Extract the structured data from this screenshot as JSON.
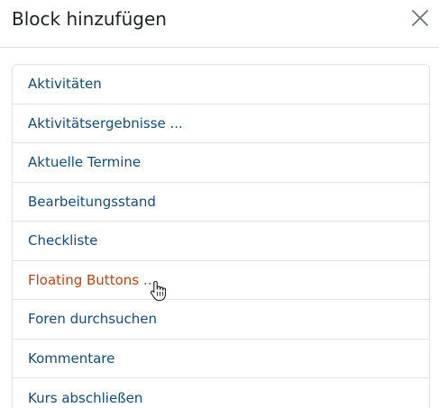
{
  "dialog": {
    "title": "Block hinzufügen",
    "close_icon": "close-icon"
  },
  "blocks": [
    {
      "label": "Aktivitäten",
      "state": "normal"
    },
    {
      "label": "Aktivitätsergebnisse ...",
      "state": "normal"
    },
    {
      "label": "Aktuelle Termine",
      "state": "normal"
    },
    {
      "label": "Bearbeitungsstand",
      "state": "normal"
    },
    {
      "label": "Checkliste",
      "state": "normal"
    },
    {
      "label": "Floating Buttons ...",
      "state": "hover"
    },
    {
      "label": "Foren durchsuchen",
      "state": "normal"
    },
    {
      "label": "Kommentare",
      "state": "normal"
    },
    {
      "label": "Kurs abschließen",
      "state": "normal"
    }
  ],
  "colors": {
    "link": "#0f4c81",
    "hover": "#c4410b",
    "title": "#1d2125",
    "border": "#dee2e6"
  },
  "cursor_icon": "hand-pointer-icon"
}
